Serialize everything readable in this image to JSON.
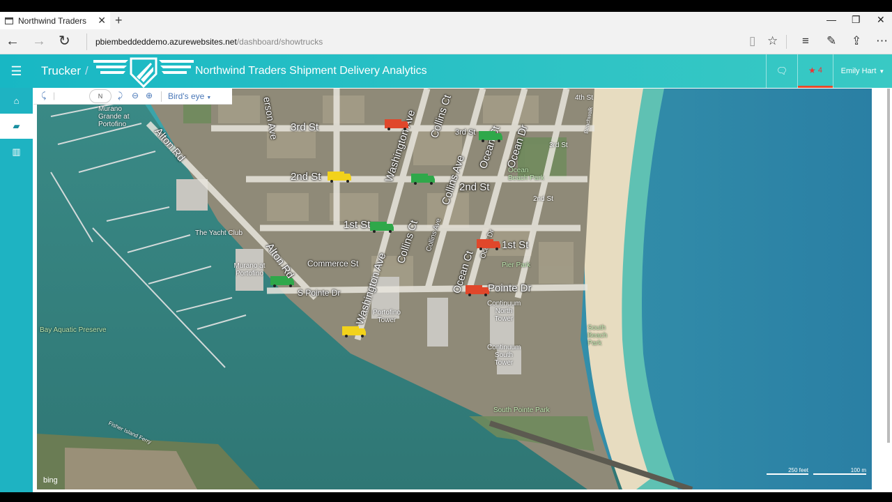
{
  "browser": {
    "tab_title": "Northwind Traders",
    "url_host": "pbiembeddeddemo.azurewebsites.net",
    "url_path": "/dashboard/showtrucks"
  },
  "header": {
    "breadcrumb": "Trucker",
    "breadcrumb_sep": "/",
    "title": "Northwind Traders Shipment Delivery Analytics",
    "alert_count": "4",
    "user_name": "Emily Hart"
  },
  "map_toolbar": {
    "compass": "N",
    "view_mode": "Bird's eye"
  },
  "map": {
    "streets": [
      "3rd St",
      "2nd St",
      "1st St",
      "Commerce St",
      "S Pointe Dr",
      "Washington Ave",
      "Collins Ct",
      "Collins Ave",
      "Ocean Ct",
      "Ocean Dr",
      "Alton Rd",
      "2nd St",
      "1st St",
      "Pointe Dr",
      "3rd St",
      "Alton Rd",
      "Washington Ave",
      "Collins Ct",
      "Ocean Ct",
      "Collins Ave",
      "Ocean Dr",
      "erson Ave"
    ],
    "places": [
      "Murano Grande at Portofino",
      "The Yacht Club",
      "Murano at Portofino",
      "Portofino Tower",
      "Continuum North Tower",
      "Continuum South Tower",
      "Ocean Beach Park",
      "Pier Park",
      "South Pointe Park",
      "South Beach Park",
      "Bay Aquatic Preserve",
      "4th St",
      "3rd St",
      "2nd St",
      "Beachwalk",
      "Fisher Island Ferry"
    ],
    "trucks": [
      {
        "color": "#e0472b"
      },
      {
        "color": "#2fa84a"
      },
      {
        "color": "#f2d21b"
      },
      {
        "color": "#2fa84a"
      },
      {
        "color": "#2fa84a"
      },
      {
        "color": "#e0472b"
      },
      {
        "color": "#2fa84a"
      },
      {
        "color": "#e0472b"
      },
      {
        "color": "#f2d21b"
      }
    ],
    "scale_feet": "250 feet",
    "scale_m": "100 m",
    "attribution": "bing"
  }
}
